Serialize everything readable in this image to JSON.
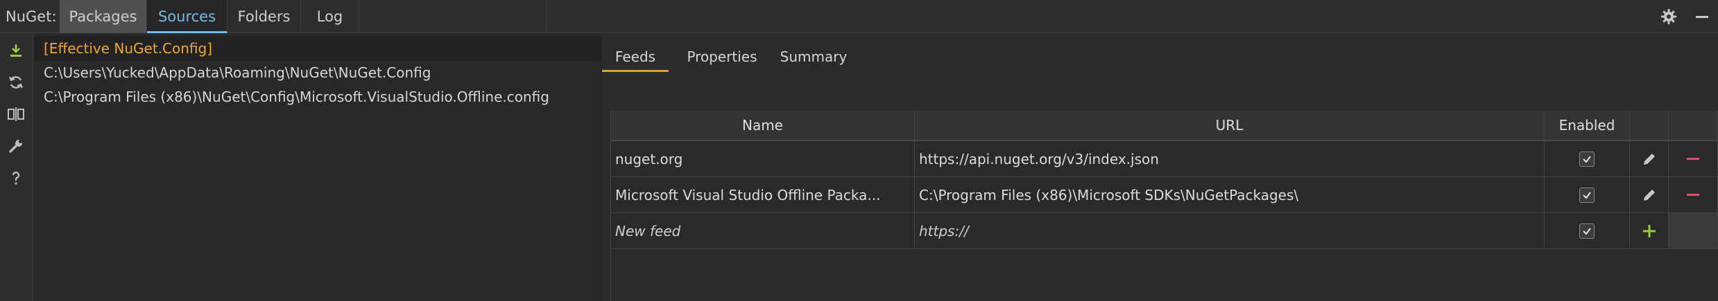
{
  "app": {
    "prefix": "NuGet:"
  },
  "top_tabs": [
    {
      "label": "Packages"
    },
    {
      "label": "Sources"
    },
    {
      "label": "Folders"
    },
    {
      "label": "Log"
    }
  ],
  "icons": {
    "settings": "gear-icon",
    "minimize": "minimize-icon",
    "side": [
      "download-icon",
      "refresh-icon",
      "compare-icon",
      "wrench-icon",
      "help-icon"
    ]
  },
  "configs": [
    {
      "label": "[Effective NuGet.Config]"
    },
    {
      "label": "C:\\Users\\Yucked\\AppData\\Roaming\\NuGet\\NuGet.Config"
    },
    {
      "label": "C:\\Program Files (x86)\\NuGet\\Config\\Microsoft.VisualStudio.Offline.config"
    }
  ],
  "sub_tabs": [
    {
      "label": "Feeds"
    },
    {
      "label": "Properties"
    },
    {
      "label": "Summary"
    }
  ],
  "feeds": {
    "columns": {
      "name": "Name",
      "url": "URL",
      "enabled": "Enabled"
    },
    "rows": [
      {
        "name": "nuget.org",
        "url": "https://api.nuget.org/v3/index.json",
        "enabled": true
      },
      {
        "name": "Microsoft Visual Studio Offline Packa...",
        "url": "C:\\Program Files (x86)\\Microsoft SDKs\\NuGetPackages\\",
        "enabled": true
      }
    ],
    "new_row": {
      "name_placeholder": "New feed",
      "url_placeholder": "https://",
      "enabled": true
    }
  },
  "colors": {
    "accent_blue": "#72bde8",
    "active_config": "#f0a830",
    "tab_underline": "#e2a124",
    "download_green": "#9ccc3c",
    "add_green": "#9ccc3c",
    "remove_red": "#e0506e"
  }
}
